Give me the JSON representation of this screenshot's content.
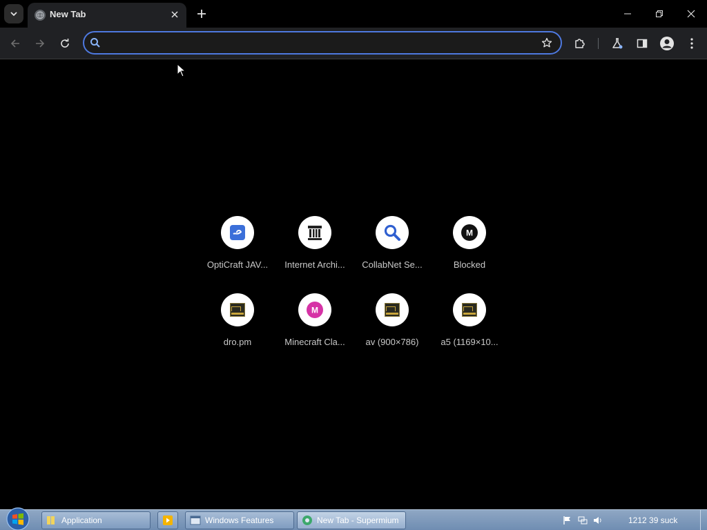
{
  "browser": {
    "tab": {
      "title": "New Tab",
      "favicon": "globe-icon"
    },
    "omnibox": {
      "value": "",
      "placeholder": ""
    }
  },
  "shortcuts": [
    {
      "label": "OptiCraft JAV...",
      "icon": "opticraft-icon"
    },
    {
      "label": "Internet Archi...",
      "icon": "archive-icon"
    },
    {
      "label": "CollabNet Se...",
      "icon": "search-icon"
    },
    {
      "label": "Blocked",
      "icon": "m-black-icon"
    },
    {
      "label": "dro.pm",
      "icon": "image-icon"
    },
    {
      "label": "Minecraft Cla...",
      "icon": "m-pink-icon"
    },
    {
      "label": "av (900×786)",
      "icon": "image-icon"
    },
    {
      "label": "a5 (1169×10...",
      "icon": "image-icon"
    }
  ],
  "taskbar": {
    "items": [
      {
        "label": "Application"
      },
      {
        "label": ""
      },
      {
        "label": "Windows Features"
      },
      {
        "label": "New Tab - Supermium"
      }
    ],
    "clock": "1212 39 suck"
  },
  "colors": {
    "background": "#000000",
    "toolbar": "#202124",
    "omnibox_border": "#4e79e0",
    "accent_blue": "#3b6fd9",
    "pink": "#d633a6"
  }
}
